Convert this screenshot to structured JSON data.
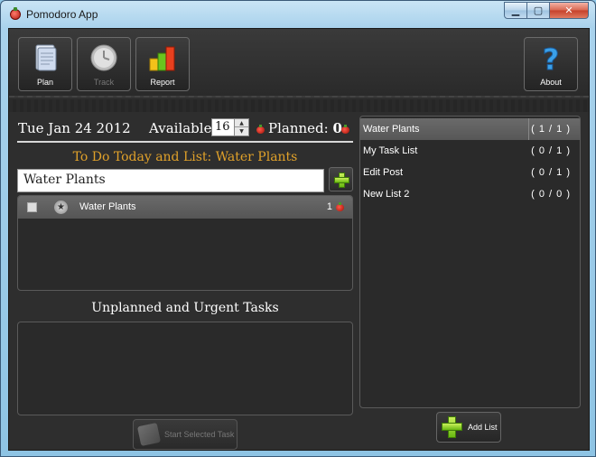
{
  "window": {
    "title": "Pomodoro App"
  },
  "window_controls": {
    "minimize": "▁",
    "maximize": "▢",
    "close": "✕"
  },
  "toolbar": {
    "plan": "Plan",
    "track": "Track",
    "report": "Report",
    "about": "About"
  },
  "header": {
    "date": "Tue Jan 24 2012",
    "available_label": "Available:",
    "available_value": "16",
    "planned_label": "Planned:",
    "planned_value": "0"
  },
  "todo": {
    "heading": "To Do Today and List: Water Plants",
    "input_value": "Water Plants",
    "tasks": [
      {
        "name": "Water Plants",
        "count": "1"
      }
    ]
  },
  "unplanned": {
    "heading": "Unplanned and Urgent Tasks"
  },
  "start_button": {
    "label": "Start Selected Task"
  },
  "lists": {
    "items": [
      {
        "name": "Water Plants",
        "count": "( 1 / 1 )"
      },
      {
        "name": "My Task List",
        "count": "( 0 / 1 )"
      },
      {
        "name": "Edit Post",
        "count": "( 0 / 1 )"
      },
      {
        "name": "New List 2",
        "count": "( 0 / 0 )"
      }
    ]
  },
  "add_list_button": {
    "label": "Add List"
  },
  "colors": {
    "accent_heading": "#e0a12a",
    "panel_bg": "#2e2e2e",
    "selected_row": "#606060"
  }
}
